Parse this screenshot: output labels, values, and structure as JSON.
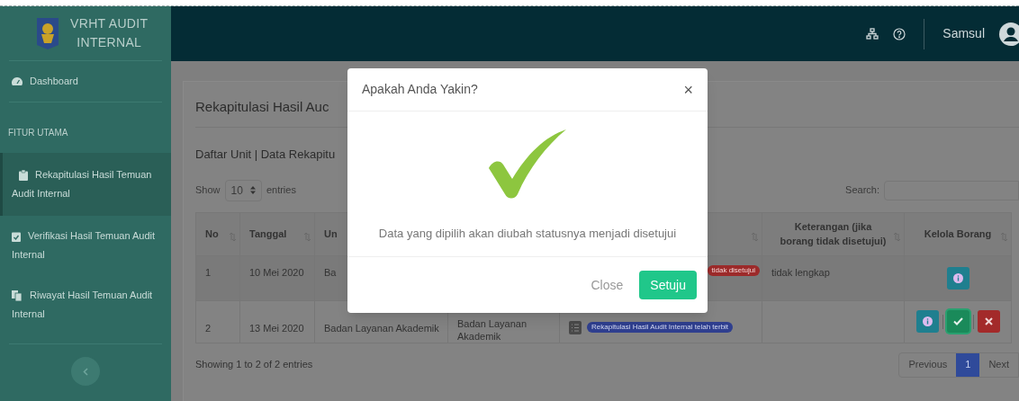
{
  "sidebar": {
    "brand": [
      "VRHT AUDIT",
      "INTERNAL"
    ],
    "items": [
      {
        "kind": "link",
        "label": "Dashboard",
        "selected": false
      },
      {
        "kind": "heading",
        "label": "FITUR UTAMA"
      },
      {
        "kind": "link",
        "label": "Rekapitulasi Hasil Temuan Audit Internal",
        "selected": true
      },
      {
        "kind": "link",
        "label": "Verifikasi Hasil Temuan Audit Internal",
        "selected": false
      },
      {
        "kind": "link",
        "label": "Riwayat Hasil Temuan Audit Internal",
        "selected": false
      }
    ]
  },
  "header": {
    "user": "Samsul"
  },
  "page": {
    "title": "Rekapitulasi Hasil Auc",
    "subtitle": "Daftar Unit | Data Rekapitu",
    "show_label": "Show",
    "page_size": "10",
    "entries_label": "entries",
    "search_label": "Search:",
    "table": {
      "columns": [
        "No",
        "Tanggal",
        "Un",
        "",
        "",
        "Keterangan (jika borang tidak disetujui)",
        "Kelola Borang"
      ],
      "rows": [
        {
          "no": "1",
          "date": "10 Mei 2020",
          "unit": "Ba",
          "status": {
            "kind": "rejected",
            "text": "tidak disetujui"
          },
          "note": "tidak lengkap",
          "actions": [
            {
              "kind": "info"
            }
          ]
        },
        {
          "no": "2",
          "date": "13 Mei 2020",
          "unit": "Badan Layanan Akademik",
          "unit_detail": "Badan Layanan Akademik",
          "status": {
            "kind": "published",
            "text": "Rekapitulasi Hasil Audit Internal telah terbit"
          },
          "note": "",
          "actions": [
            {
              "kind": "info"
            },
            {
              "kind": "approve"
            },
            {
              "kind": "reject"
            }
          ]
        }
      ]
    },
    "info": "Showing 1 to 2 of 2 entries",
    "pagination": [
      {
        "label": "Previous",
        "selected": false
      },
      {
        "label": "1",
        "selected": true
      },
      {
        "label": "Next",
        "selected": false
      }
    ]
  },
  "modal": {
    "title": "Apakah Anda Yakin?",
    "close": "×",
    "message": "Data yang dipilih akan diubah statusnya menjadi disetujui",
    "buttons": [
      {
        "kind": "secondary",
        "label": "Close"
      },
      {
        "kind": "primary",
        "label": "Setuju"
      }
    ]
  }
}
